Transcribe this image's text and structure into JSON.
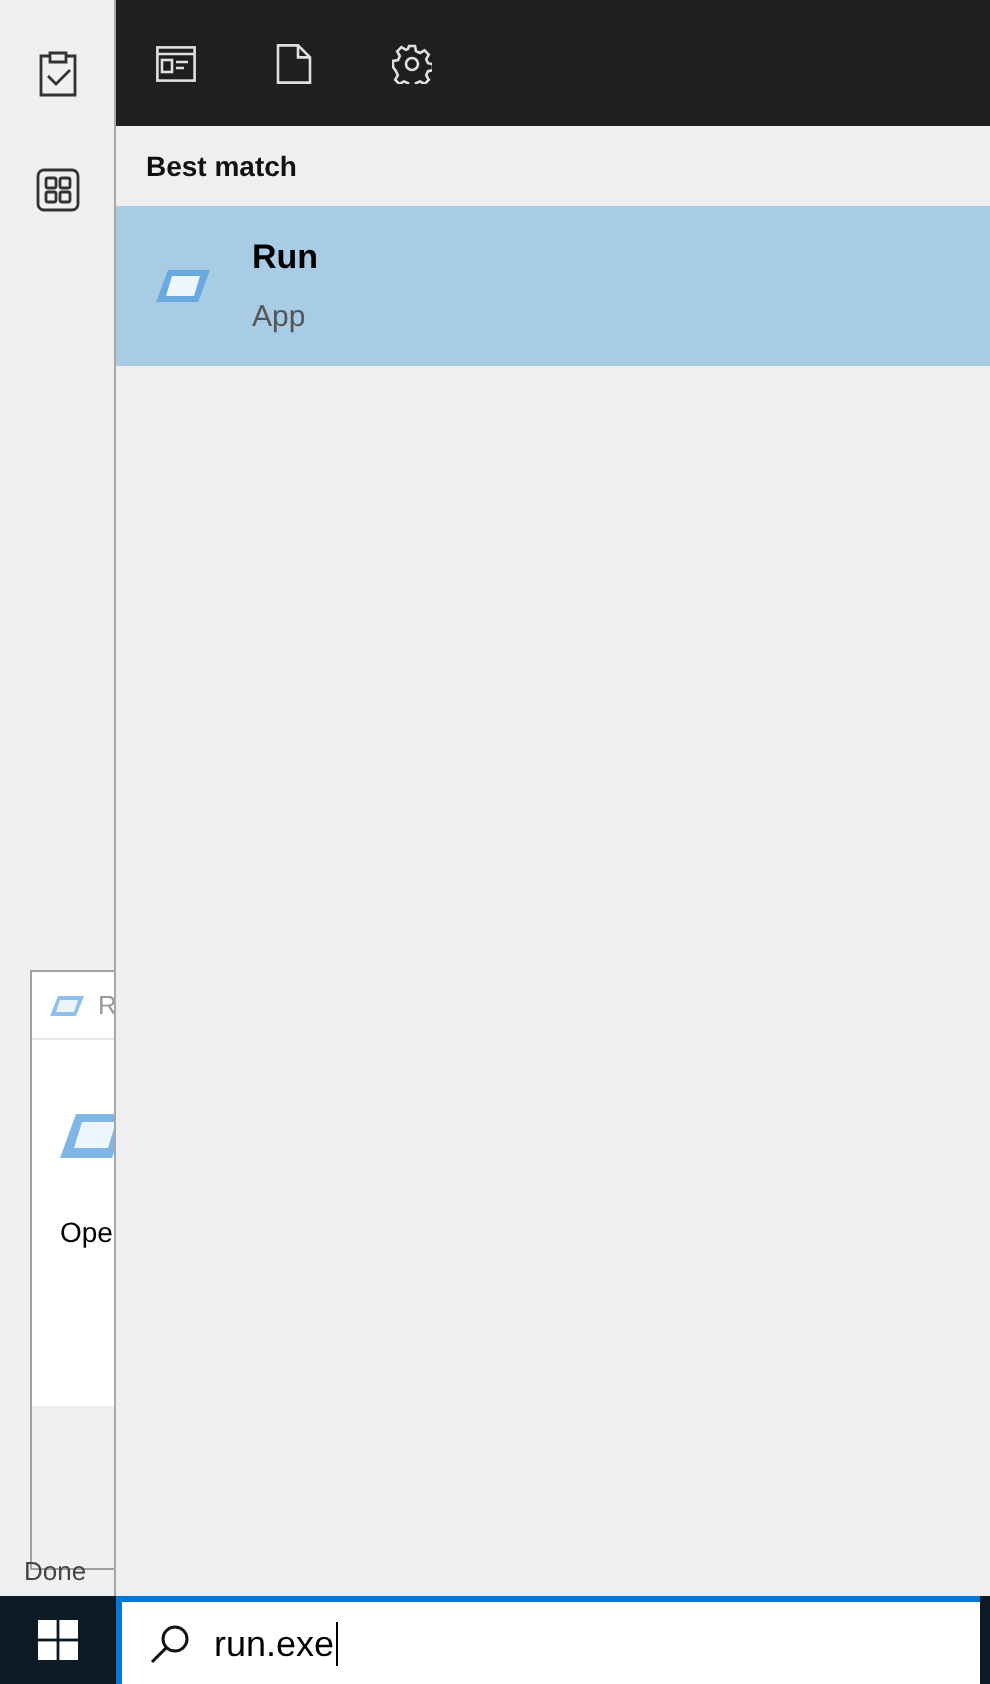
{
  "background_window": {
    "title": "R",
    "text": "Ope"
  },
  "background_status": "Done",
  "results": {
    "heading": "Best match",
    "items": [
      {
        "title": "Run",
        "subtitle": "App",
        "selected": true
      }
    ]
  },
  "search": {
    "value": "run.exe"
  }
}
